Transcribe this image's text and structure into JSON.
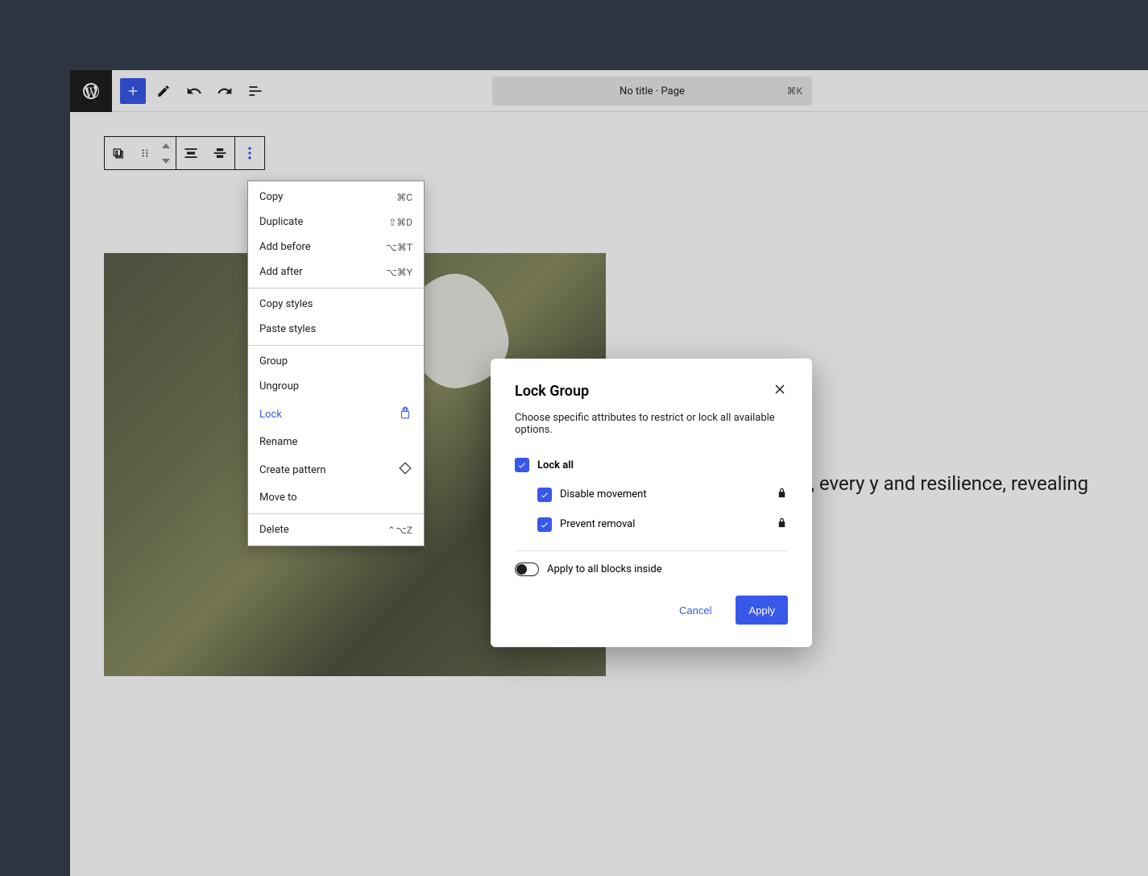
{
  "header": {
    "title": "No title · Page",
    "shortcut": "⌘K"
  },
  "dropdown": {
    "groups": [
      [
        {
          "label": "Copy",
          "shortcut": "⌘C"
        },
        {
          "label": "Duplicate",
          "shortcut": "⇧⌘D"
        },
        {
          "label": "Add before",
          "shortcut": "⌥⌘T"
        },
        {
          "label": "Add after",
          "shortcut": "⌥⌘Y"
        }
      ],
      [
        {
          "label": "Copy styles"
        },
        {
          "label": "Paste styles"
        }
      ],
      [
        {
          "label": "Group"
        },
        {
          "label": "Ungroup"
        },
        {
          "label": "Lock",
          "icon": "lock",
          "active": true
        },
        {
          "label": "Rename"
        },
        {
          "label": "Create pattern",
          "icon": "diamond"
        },
        {
          "label": "Move to"
        }
      ],
      [
        {
          "label": "Delete",
          "shortcut": "⌃⌥Z"
        }
      ]
    ]
  },
  "modal": {
    "title": "Lock Group",
    "description": "Choose specific attributes to restrict or lock all available options.",
    "lock_all_label": "Lock all",
    "disable_movement_label": "Disable movement",
    "prevent_removal_label": "Prevent removal",
    "apply_inside_label": "Apply to all blocks inside",
    "cancel_label": "Cancel",
    "apply_label": "Apply"
  },
  "content": {
    "text_fragment": "n unexpected places, every y and resilience, revealing"
  }
}
